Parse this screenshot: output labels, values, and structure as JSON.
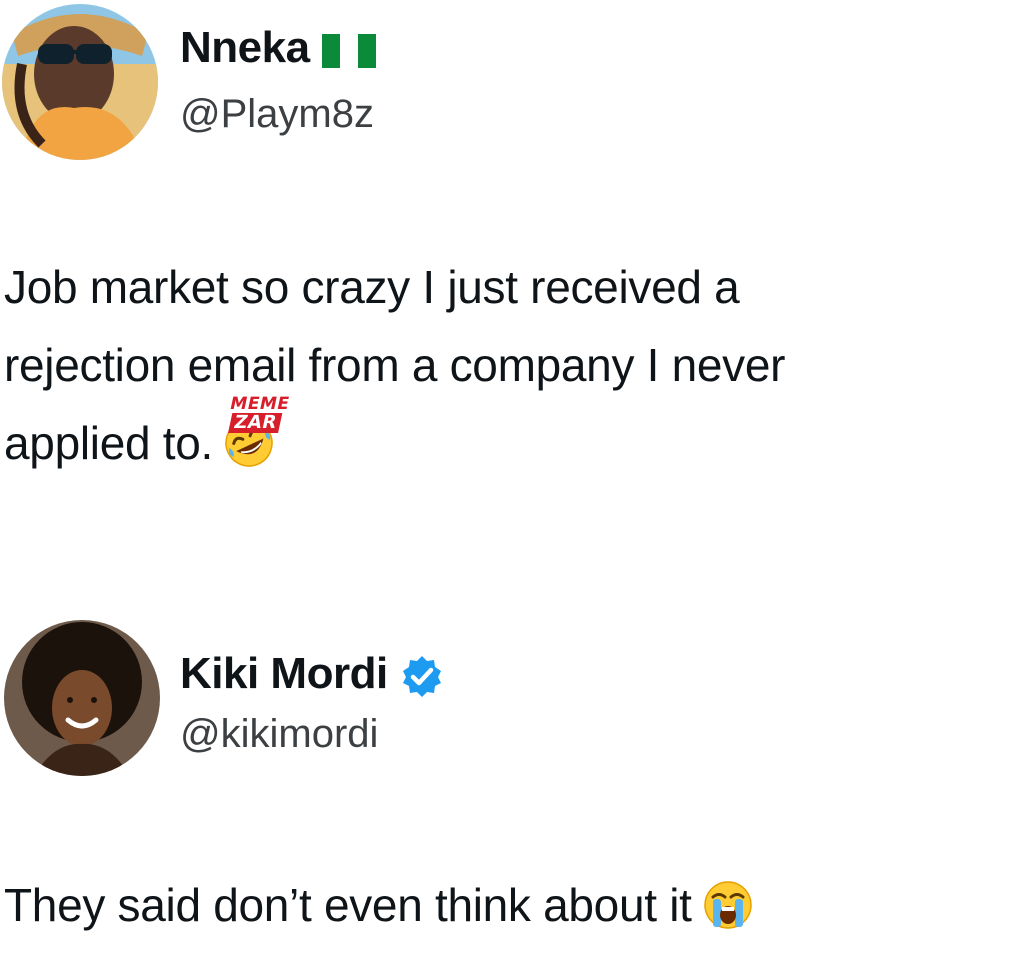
{
  "tweets": [
    {
      "display_name": "Nneka",
      "handle": "@Playm8z",
      "name_badge_icon": "nigeria-flag-icon",
      "text_lines": [
        "Job market so crazy I just received a",
        "rejection email from a company I never",
        "applied to."
      ],
      "trailing_emoji_icon": "rolling-on-floor-laughing-emoji",
      "avatar_icon": "user-avatar-photo"
    },
    {
      "display_name": "Kiki Mordi",
      "handle": "@kikimordi",
      "name_badge_icon": "verified-badge-icon",
      "text_lines": [
        "They said don’t even think about it"
      ],
      "trailing_emoji_icon": "loudly-crying-face-emoji",
      "avatar_icon": "user-avatar-photo"
    }
  ],
  "watermark": {
    "top": "MEME",
    "bottom": "ZAR"
  },
  "colors": {
    "text": "#0f1419",
    "handle": "#3c4043",
    "verified_blue": "#1d9bf0",
    "flag_green": "#0b8a3a",
    "watermark_red": "#d61f2a"
  }
}
